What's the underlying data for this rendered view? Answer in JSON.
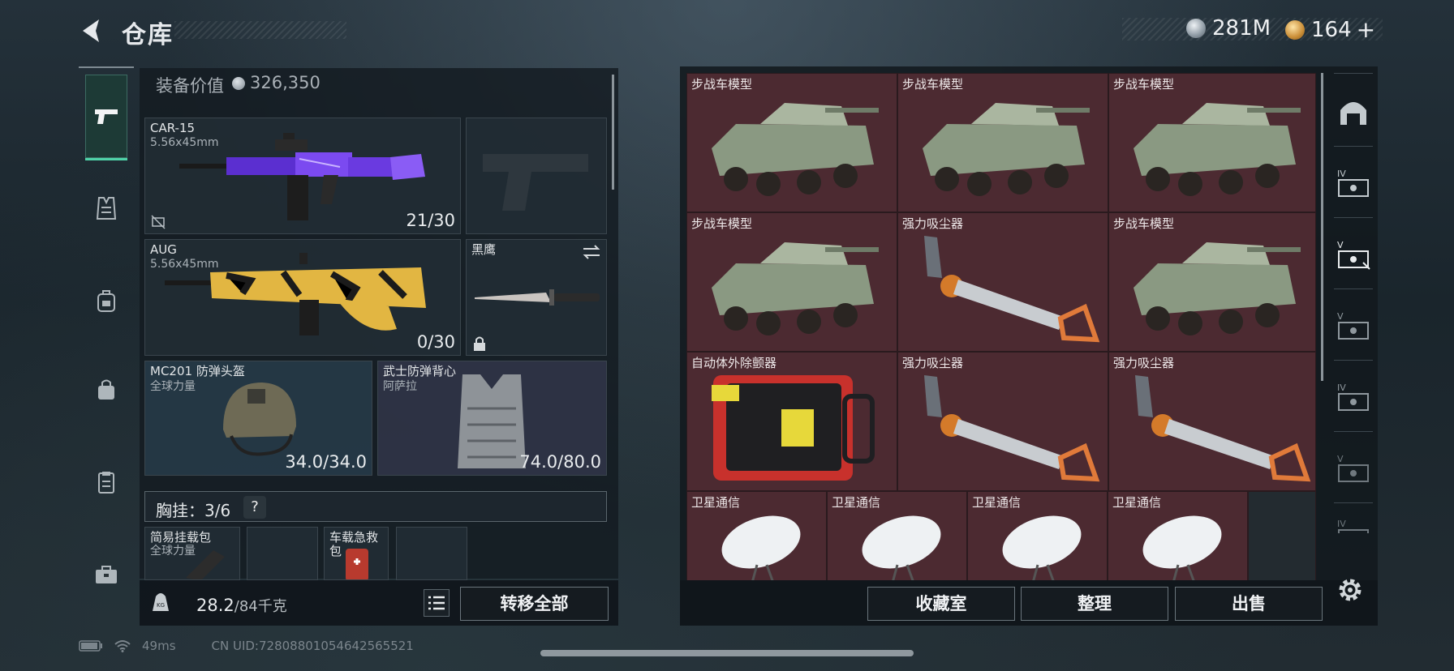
{
  "header": {
    "title": "仓库",
    "currency_silver": "281M",
    "currency_gold": "164",
    "currency_plus": "+"
  },
  "sidebar": {
    "items": [
      {
        "name": "weapons",
        "icon": "pistol-icon",
        "active": true
      },
      {
        "name": "armor",
        "icon": "vest-icon",
        "active": false
      },
      {
        "name": "backpack",
        "icon": "backpack-icon",
        "active": false
      },
      {
        "name": "bag",
        "icon": "bag-icon",
        "active": false
      },
      {
        "name": "medical",
        "icon": "clipboard-icon",
        "active": false
      },
      {
        "name": "toolbox",
        "icon": "briefcase-icon",
        "active": false
      }
    ]
  },
  "loadout": {
    "gear_value_label": "装备价值",
    "gear_value": "326,350",
    "primary": {
      "name": "CAR-15",
      "caliber": "5.56x45mm",
      "ammo": "21/30"
    },
    "secondary": {
      "name": "AUG",
      "caliber": "5.56x45mm",
      "ammo": "0/30"
    },
    "melee": {
      "name": "黑鹰"
    },
    "helmet": {
      "name": "MC201 防弹头盔",
      "brand": "全球力量",
      "durability": "34.0/34.0"
    },
    "vest": {
      "name": "武士防弹背心",
      "brand": "阿萨拉",
      "durability": "74.0/80.0"
    },
    "chest_rig": {
      "label": "胸挂：3/6",
      "help": "?"
    },
    "rig_items": [
      {
        "name": "简易挂载包",
        "brand": "全球力量"
      },
      {
        "name": "",
        "brand": ""
      },
      {
        "name": "车载急救包",
        "brand": ""
      },
      {
        "name": "",
        "brand": ""
      }
    ],
    "weight": "28.2",
    "weight_max": "/84千克",
    "transfer_all": "转移全部"
  },
  "warehouse": {
    "items": [
      {
        "name": "步战车模型",
        "type": "apc"
      },
      {
        "name": "步战车模型",
        "type": "apc"
      },
      {
        "name": "步战车模型",
        "type": "apc"
      },
      {
        "name": "步战车模型",
        "type": "apc"
      },
      {
        "name": "强力吸尘器",
        "type": "vacuum"
      },
      {
        "name": "步战车模型",
        "type": "apc"
      },
      {
        "name": "自动体外除颤器",
        "type": "aed"
      },
      {
        "name": "强力吸尘器",
        "type": "vacuum"
      },
      {
        "name": "强力吸尘器",
        "type": "vacuum"
      },
      {
        "name": "卫星通信",
        "type": "dish"
      },
      {
        "name": "卫星通信",
        "type": "dish"
      },
      {
        "name": "卫星通信",
        "type": "dish"
      },
      {
        "name": "卫星通信",
        "type": "dish"
      }
    ],
    "buttons": {
      "collection": "收藏室",
      "organize": "整理",
      "sell": "出售"
    }
  },
  "categories": [
    {
      "icon": "arch-icon",
      "tier": ""
    },
    {
      "icon": "safe-iv-icon",
      "tier": "IV"
    },
    {
      "icon": "safe-v-icon",
      "tier": "V"
    },
    {
      "icon": "safe-v2-icon",
      "tier": "V"
    },
    {
      "icon": "safe-iv2-icon",
      "tier": "IV"
    },
    {
      "icon": "safe-v3-icon",
      "tier": "V"
    },
    {
      "icon": "safe-iv3-icon",
      "tier": "IV"
    }
  ],
  "status": {
    "ping": "49ms",
    "uid": "CN UID:7280880105464256552​1"
  },
  "colors": {
    "accent": "#4fd3a8",
    "item_red": "#4c2a31"
  }
}
